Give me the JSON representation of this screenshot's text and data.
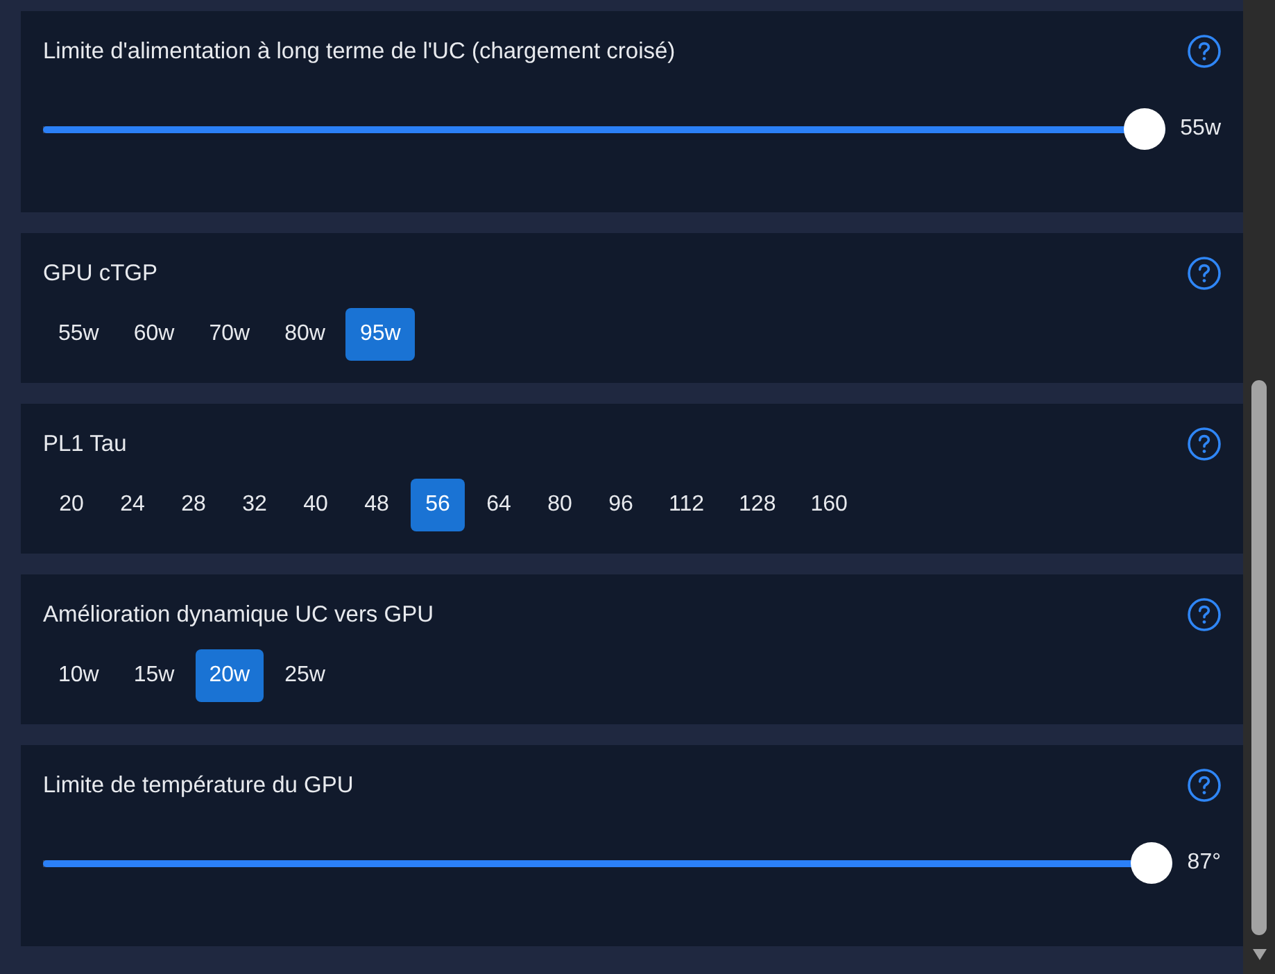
{
  "cards": [
    {
      "kind": "slider",
      "title": "Limite d'alimentation à long terme de l'UC (chargement croisé)",
      "level": 1,
      "reading": "55w"
    },
    {
      "kind": "options",
      "title": "GPU cTGP",
      "options": [
        {
          "label": "55w",
          "selected": false
        },
        {
          "label": "60w",
          "selected": false
        },
        {
          "label": "70w",
          "selected": false
        },
        {
          "label": "80w",
          "selected": false
        },
        {
          "label": "95w",
          "selected": true
        }
      ]
    },
    {
      "kind": "options",
      "title": "PL1 Tau",
      "options": [
        {
          "label": "20",
          "selected": false
        },
        {
          "label": "24",
          "selected": false
        },
        {
          "label": "28",
          "selected": false
        },
        {
          "label": "32",
          "selected": false
        },
        {
          "label": "40",
          "selected": false
        },
        {
          "label": "48",
          "selected": false
        },
        {
          "label": "56",
          "selected": true
        },
        {
          "label": "64",
          "selected": false
        },
        {
          "label": "80",
          "selected": false
        },
        {
          "label": "96",
          "selected": false
        },
        {
          "label": "112",
          "selected": false
        },
        {
          "label": "128",
          "selected": false
        },
        {
          "label": "160",
          "selected": false
        }
      ]
    },
    {
      "kind": "options",
      "title": "Amélioration dynamique UC vers GPU",
      "options": [
        {
          "label": "10w",
          "selected": false
        },
        {
          "label": "15w",
          "selected": false
        },
        {
          "label": "20w",
          "selected": true
        },
        {
          "label": "25w",
          "selected": false
        }
      ]
    },
    {
      "kind": "slider",
      "title": "Limite de température du GPU",
      "level": 1,
      "reading": "87°"
    }
  ]
}
